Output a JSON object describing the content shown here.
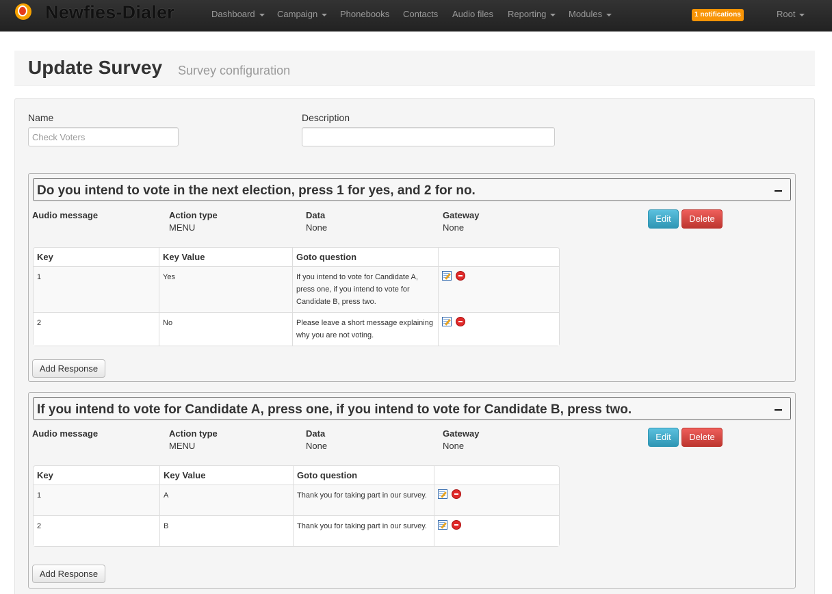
{
  "navbar": {
    "brand": "Newfies-Dialer",
    "items": [
      {
        "label": "Dashboard",
        "dropdown": true
      },
      {
        "label": "Campaign",
        "dropdown": true
      },
      {
        "label": "Phonebooks",
        "dropdown": false
      },
      {
        "label": "Contacts",
        "dropdown": false
      },
      {
        "label": "Audio files",
        "dropdown": false
      },
      {
        "label": "Reporting",
        "dropdown": true
      },
      {
        "label": "Modules",
        "dropdown": true
      }
    ],
    "notifications": "1 notifications",
    "user": "Root"
  },
  "header": {
    "title": "Update Survey",
    "subtitle": "Survey configuration"
  },
  "form": {
    "name_label": "Name",
    "name_placeholder": "Check Voters",
    "name_value": "",
    "description_label": "Description",
    "description_value": ""
  },
  "labels": {
    "audio_message": "Audio message",
    "action_type": "Action type",
    "data": "Data",
    "gateway": "Gateway",
    "edit": "Edit",
    "delete": "Delete",
    "add_response": "Add Response",
    "col_key": "Key",
    "col_key_value": "Key Value",
    "col_goto": "Goto question"
  },
  "questions": [
    {
      "title": "Do you intend to vote in the next election, press 1 for yes, and 2 for no.",
      "audio_message": "",
      "action_type": "MENU",
      "data": "None",
      "gateway": "None",
      "responses": [
        {
          "key": "1",
          "key_value": "Yes",
          "goto": "If you intend to vote for Candidate A, press one, if you intend to vote for Candidate B, press two."
        },
        {
          "key": "2",
          "key_value": "No",
          "goto": "Please leave a short message explaining why you are not voting."
        }
      ]
    },
    {
      "title": "If you intend to vote for Candidate A, press one, if you intend to vote for Candidate B, press two.",
      "audio_message": "",
      "action_type": "MENU",
      "data": "None",
      "gateway": "None",
      "responses": [
        {
          "key": "1",
          "key_value": "A",
          "goto": "Thank you for taking part in our survey."
        },
        {
          "key": "2",
          "key_value": "B",
          "goto": "Thank you for taking part in our survey."
        }
      ]
    }
  ]
}
